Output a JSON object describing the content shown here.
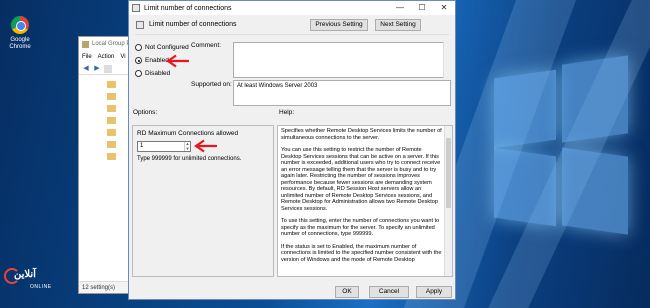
{
  "desktop": {
    "chrome_icon": {
      "icon": "chrome-icon",
      "label_line1": "Google",
      "label_line2": "Chrome"
    }
  },
  "gpedit": {
    "title": "Local Group P",
    "menu": [
      "File",
      "Action",
      "Vi"
    ],
    "status": "12 setting(s)"
  },
  "dialog": {
    "title": "Limit number of connections",
    "header_title": "Limit number of connections",
    "prev_button": "Previous Setting",
    "next_button": "Next Setting",
    "radio_options": [
      {
        "label": "Not Configured",
        "selected": false
      },
      {
        "label": "Enabled",
        "selected": true
      },
      {
        "label": "Disabled",
        "selected": false
      }
    ],
    "comment_label": "Comment:",
    "comment_value": "",
    "supported_label": "Supported on:",
    "supported_value": "At least Windows Server 2003",
    "options_label": "Options:",
    "help_label": "Help:",
    "rd_label": "RD Maximum Connections allowed",
    "rd_value": "1",
    "rd_hint": "Type 999999 for unlimited connections.",
    "help_paragraphs": [
      "Specifies whether Remote Desktop Services limits the number of simultaneous connections to the server.",
      "You can use this setting to restrict the number of Remote Desktop Services sessions that can be active on a server. If this number is exceeded, additional users who try to connect receive an error message telling them that the server is busy and to try again later. Restricting the number of sessions improves performance because fewer sessions are demanding system resources. By default, RD Session Host servers allow an unlimited number of Remote Desktop Services sessions, and Remote Desktop for Administration allows two Remote Desktop Services sessions.",
      "To use this setting, enter the number of connections you want to specify as the maximum for the server. To specify an unlimited number of connections, type 999999.",
      "If the status is set to Enabled, the maximum number of connections is limited to the specified number consistent with the version of Windows and the mode of Remote Desktop"
    ],
    "ok_button": "OK",
    "cancel_button": "Cancel",
    "apply_button": "Apply"
  },
  "watermark": {
    "text": "آنلاین",
    "sub": "ONLINE"
  },
  "colors": {
    "annotation_arrow": "#e8161e",
    "desktop_blue": "#0a4f96"
  }
}
